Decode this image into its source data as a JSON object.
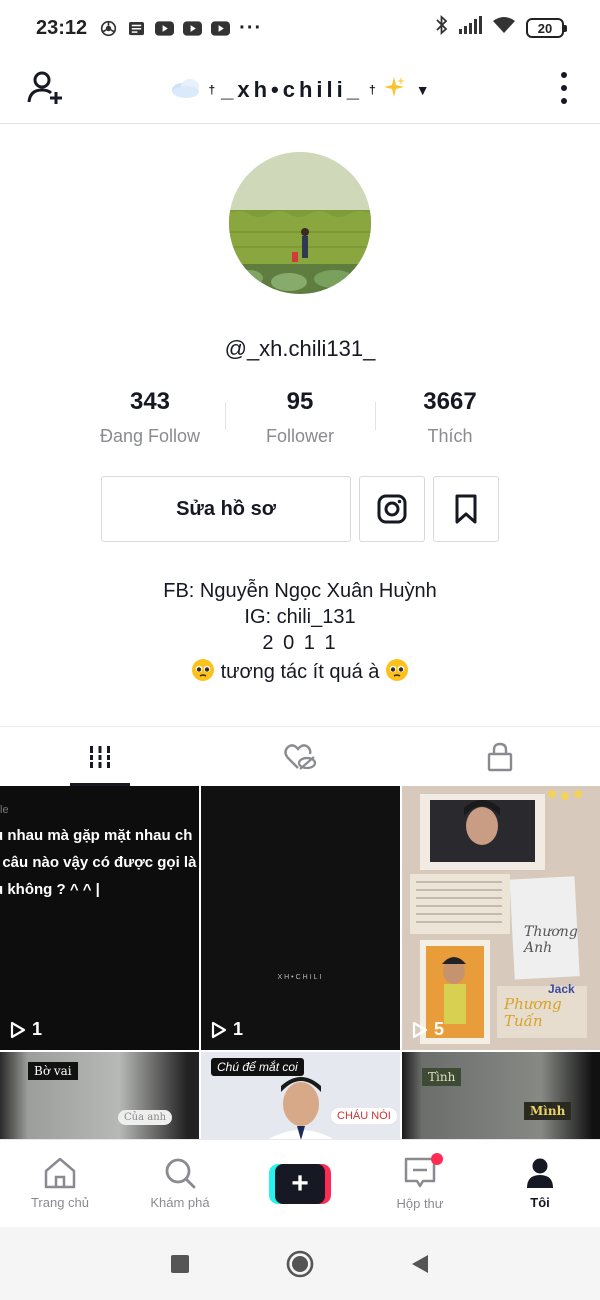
{
  "status_bar": {
    "time": "23:12",
    "more_indicator": "···",
    "battery": "20",
    "icons_left": [
      "chrome-icon",
      "news-icon",
      "youtube-icon",
      "youtube-icon",
      "youtube-icon"
    ],
    "icons_right": [
      "bluetooth-icon",
      "signal-icon",
      "wifi-icon",
      "battery-icon"
    ]
  },
  "header": {
    "title": "_xh•chili_",
    "title_prefix_emoji": "cloud-emoji",
    "title_suffix_emoji": "sparkles-emoji",
    "cross_mark": "†"
  },
  "profile": {
    "username": "@_xh.chili131_",
    "stats": [
      {
        "value": "343",
        "label": "Đang Follow"
      },
      {
        "value": "95",
        "label": "Follower"
      },
      {
        "value": "3667",
        "label": "Thích"
      }
    ],
    "edit_button": "Sửa hồ sơ",
    "bio": {
      "line1": "FB: Nguyễn Ngọc Xuân Huỳnh",
      "line2": "IG: chili_131",
      "line3": "2 0 1 1",
      "line4": "tương tác ít quá à"
    }
  },
  "tabs": [
    "videos-grid-icon",
    "liked-hidden-icon",
    "private-lock-icon"
  ],
  "videos": [
    {
      "overlay_lines": [
        "u nhau mà gặp mặt nhau ch",
        "i câu nào vậy có được gọi là",
        "u không ? ^ ^ |"
      ],
      "plays": "1"
    },
    {
      "watermark": "XH•CHILI",
      "plays": "1"
    },
    {
      "collage_texts": [
        "Thương Anh",
        "Jack",
        "Phương Tuấn"
      ],
      "plays": "5"
    },
    {
      "labels": [
        "Bờ vai",
        "Của anh"
      ]
    },
    {
      "labels": [
        "Chú để mắt coi",
        "CHÁU NÓI"
      ]
    },
    {
      "labels": [
        "Tình",
        "Mình"
      ]
    }
  ],
  "bottom_nav": [
    {
      "label": "Trang chủ",
      "icon": "home-icon"
    },
    {
      "label": "Khám phá",
      "icon": "search-icon"
    },
    {
      "label": "",
      "icon": "create-plus-icon"
    },
    {
      "label": "Hộp thư",
      "icon": "inbox-icon"
    },
    {
      "label": "Tôi",
      "icon": "profile-icon"
    }
  ],
  "colors": {
    "accent_red": "#fe2c55",
    "accent_cyan": "#25f4ee",
    "text_primary": "#161823",
    "text_secondary": "#8a8b91"
  }
}
